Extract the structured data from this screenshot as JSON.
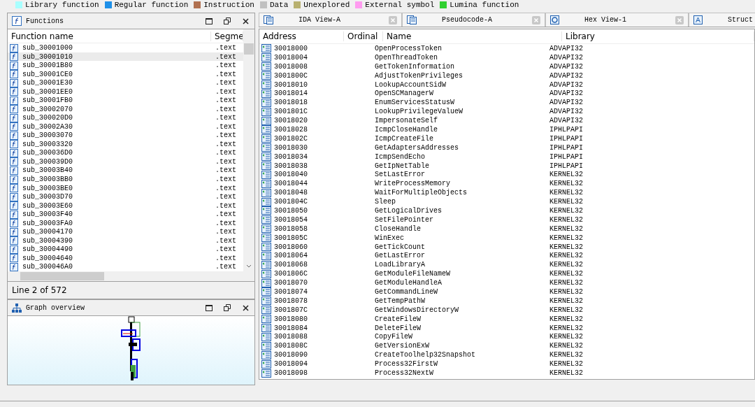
{
  "legend": [
    {
      "label": "Library function",
      "color": "#a8ffff"
    },
    {
      "label": "Regular function",
      "color": "#1e90e8"
    },
    {
      "label": "Instruction",
      "color": "#b07050"
    },
    {
      "label": "Data",
      "color": "#c0c0c0"
    },
    {
      "label": "Unexplored",
      "color": "#b8b070"
    },
    {
      "label": "External symbol",
      "color": "#ff9cf0"
    },
    {
      "label": "Lumina function",
      "color": "#30d030"
    }
  ],
  "functions": {
    "title": "Functions",
    "columns": [
      "Function name",
      "Segme"
    ],
    "rows": [
      {
        "name": "sub_30001000",
        "segment": ".text",
        "selected": false
      },
      {
        "name": "sub_30001010",
        "segment": ".text",
        "selected": true
      },
      {
        "name": "sub_30001B80",
        "segment": ".text",
        "selected": false
      },
      {
        "name": "sub_30001CE0",
        "segment": ".text",
        "selected": false
      },
      {
        "name": "sub_30001E30",
        "segment": ".text",
        "selected": false
      },
      {
        "name": "sub_30001EE0",
        "segment": ".text",
        "selected": false
      },
      {
        "name": "sub_30001FB0",
        "segment": ".text",
        "selected": false
      },
      {
        "name": "sub_30002070",
        "segment": ".text",
        "selected": false
      },
      {
        "name": "sub_300020D0",
        "segment": ".text",
        "selected": false
      },
      {
        "name": "sub_30002A30",
        "segment": ".text",
        "selected": false
      },
      {
        "name": "sub_30003070",
        "segment": ".text",
        "selected": false
      },
      {
        "name": "sub_30003320",
        "segment": ".text",
        "selected": false
      },
      {
        "name": "sub_300036D0",
        "segment": ".text",
        "selected": false
      },
      {
        "name": "sub_300039D0",
        "segment": ".text",
        "selected": false
      },
      {
        "name": "sub_30003B40",
        "segment": ".text",
        "selected": false
      },
      {
        "name": "sub_30003BB0",
        "segment": ".text",
        "selected": false
      },
      {
        "name": "sub_30003BE0",
        "segment": ".text",
        "selected": false
      },
      {
        "name": "sub_30003D70",
        "segment": ".text",
        "selected": false
      },
      {
        "name": "sub_30003E60",
        "segment": ".text",
        "selected": false
      },
      {
        "name": "sub_30003F40",
        "segment": ".text",
        "selected": false
      },
      {
        "name": "sub_30003FA0",
        "segment": ".text",
        "selected": false
      },
      {
        "name": "sub_30004170",
        "segment": ".text",
        "selected": false
      },
      {
        "name": "sub_30004390",
        "segment": ".text",
        "selected": false
      },
      {
        "name": "sub_30004490",
        "segment": ".text",
        "selected": false
      },
      {
        "name": "sub_30004640",
        "segment": ".text",
        "selected": false
      },
      {
        "name": "sub_300046A0",
        "segment": ".text",
        "selected": false
      }
    ],
    "status": "Line 2 of 572"
  },
  "graph_overview": {
    "title": "Graph overview"
  },
  "tabs": [
    {
      "label": "IDA View-A",
      "kind": "disasm"
    },
    {
      "label": "Pseudocode-A",
      "kind": "pseudo"
    },
    {
      "label": "Hex View-1",
      "kind": "hex"
    },
    {
      "label": "Struct",
      "kind": "struct"
    }
  ],
  "imports": {
    "columns": [
      "Address",
      "Ordinal",
      "Name",
      "Library"
    ],
    "rows": [
      {
        "address": "30018000",
        "name": "OpenProcessToken",
        "library": "ADVAPI32"
      },
      {
        "address": "30018004",
        "name": "OpenThreadToken",
        "library": "ADVAPI32"
      },
      {
        "address": "30018008",
        "name": "GetTokenInformation",
        "library": "ADVAPI32"
      },
      {
        "address": "3001800C",
        "name": "AdjustTokenPrivileges",
        "library": "ADVAPI32"
      },
      {
        "address": "30018010",
        "name": "LookupAccountSidW",
        "library": "ADVAPI32"
      },
      {
        "address": "30018014",
        "name": "OpenSCManagerW",
        "library": "ADVAPI32"
      },
      {
        "address": "30018018",
        "name": "EnumServicesStatusW",
        "library": "ADVAPI32"
      },
      {
        "address": "3001801C",
        "name": "LookupPrivilegeValueW",
        "library": "ADVAPI32"
      },
      {
        "address": "30018020",
        "name": "ImpersonateSelf",
        "library": "ADVAPI32"
      },
      {
        "address": "30018028",
        "name": "IcmpCloseHandle",
        "library": "IPHLPAPI"
      },
      {
        "address": "3001802C",
        "name": "IcmpCreateFile",
        "library": "IPHLPAPI"
      },
      {
        "address": "30018030",
        "name": "GetAdaptersAddresses",
        "library": "IPHLPAPI"
      },
      {
        "address": "30018034",
        "name": "IcmpSendEcho",
        "library": "IPHLPAPI"
      },
      {
        "address": "30018038",
        "name": "GetIpNetTable",
        "library": "IPHLPAPI"
      },
      {
        "address": "30018040",
        "name": "SetLastError",
        "library": "KERNEL32"
      },
      {
        "address": "30018044",
        "name": "WriteProcessMemory",
        "library": "KERNEL32"
      },
      {
        "address": "30018048",
        "name": "WaitForMultipleObjects",
        "library": "KERNEL32"
      },
      {
        "address": "3001804C",
        "name": "Sleep",
        "library": "KERNEL32"
      },
      {
        "address": "30018050",
        "name": "GetLogicalDrives",
        "library": "KERNEL32"
      },
      {
        "address": "30018054",
        "name": "SetFilePointer",
        "library": "KERNEL32"
      },
      {
        "address": "30018058",
        "name": "CloseHandle",
        "library": "KERNEL32"
      },
      {
        "address": "3001805C",
        "name": "WinExec",
        "library": "KERNEL32"
      },
      {
        "address": "30018060",
        "name": "GetTickCount",
        "library": "KERNEL32"
      },
      {
        "address": "30018064",
        "name": "GetLastError",
        "library": "KERNEL32"
      },
      {
        "address": "30018068",
        "name": "LoadLibraryA",
        "library": "KERNEL32"
      },
      {
        "address": "3001806C",
        "name": "GetModuleFileNameW",
        "library": "KERNEL32"
      },
      {
        "address": "30018070",
        "name": "GetModuleHandleA",
        "library": "KERNEL32"
      },
      {
        "address": "30018074",
        "name": "GetCommandLineW",
        "library": "KERNEL32"
      },
      {
        "address": "30018078",
        "name": "GetTempPathW",
        "library": "KERNEL32"
      },
      {
        "address": "3001807C",
        "name": "GetWindowsDirectoryW",
        "library": "KERNEL32"
      },
      {
        "address": "30018080",
        "name": "CreateFileW",
        "library": "KERNEL32"
      },
      {
        "address": "30018084",
        "name": "DeleteFileW",
        "library": "KERNEL32"
      },
      {
        "address": "30018088",
        "name": "CopyFileW",
        "library": "KERNEL32"
      },
      {
        "address": "3001808C",
        "name": "GetVersionExW",
        "library": "KERNEL32"
      },
      {
        "address": "30018090",
        "name": "CreateToolhelp32Snapshot",
        "library": "KERNEL32"
      },
      {
        "address": "30018094",
        "name": "Process32FirstW",
        "library": "KERNEL32"
      },
      {
        "address": "30018098",
        "name": "Process32NextW",
        "library": "KERNEL32"
      }
    ]
  }
}
